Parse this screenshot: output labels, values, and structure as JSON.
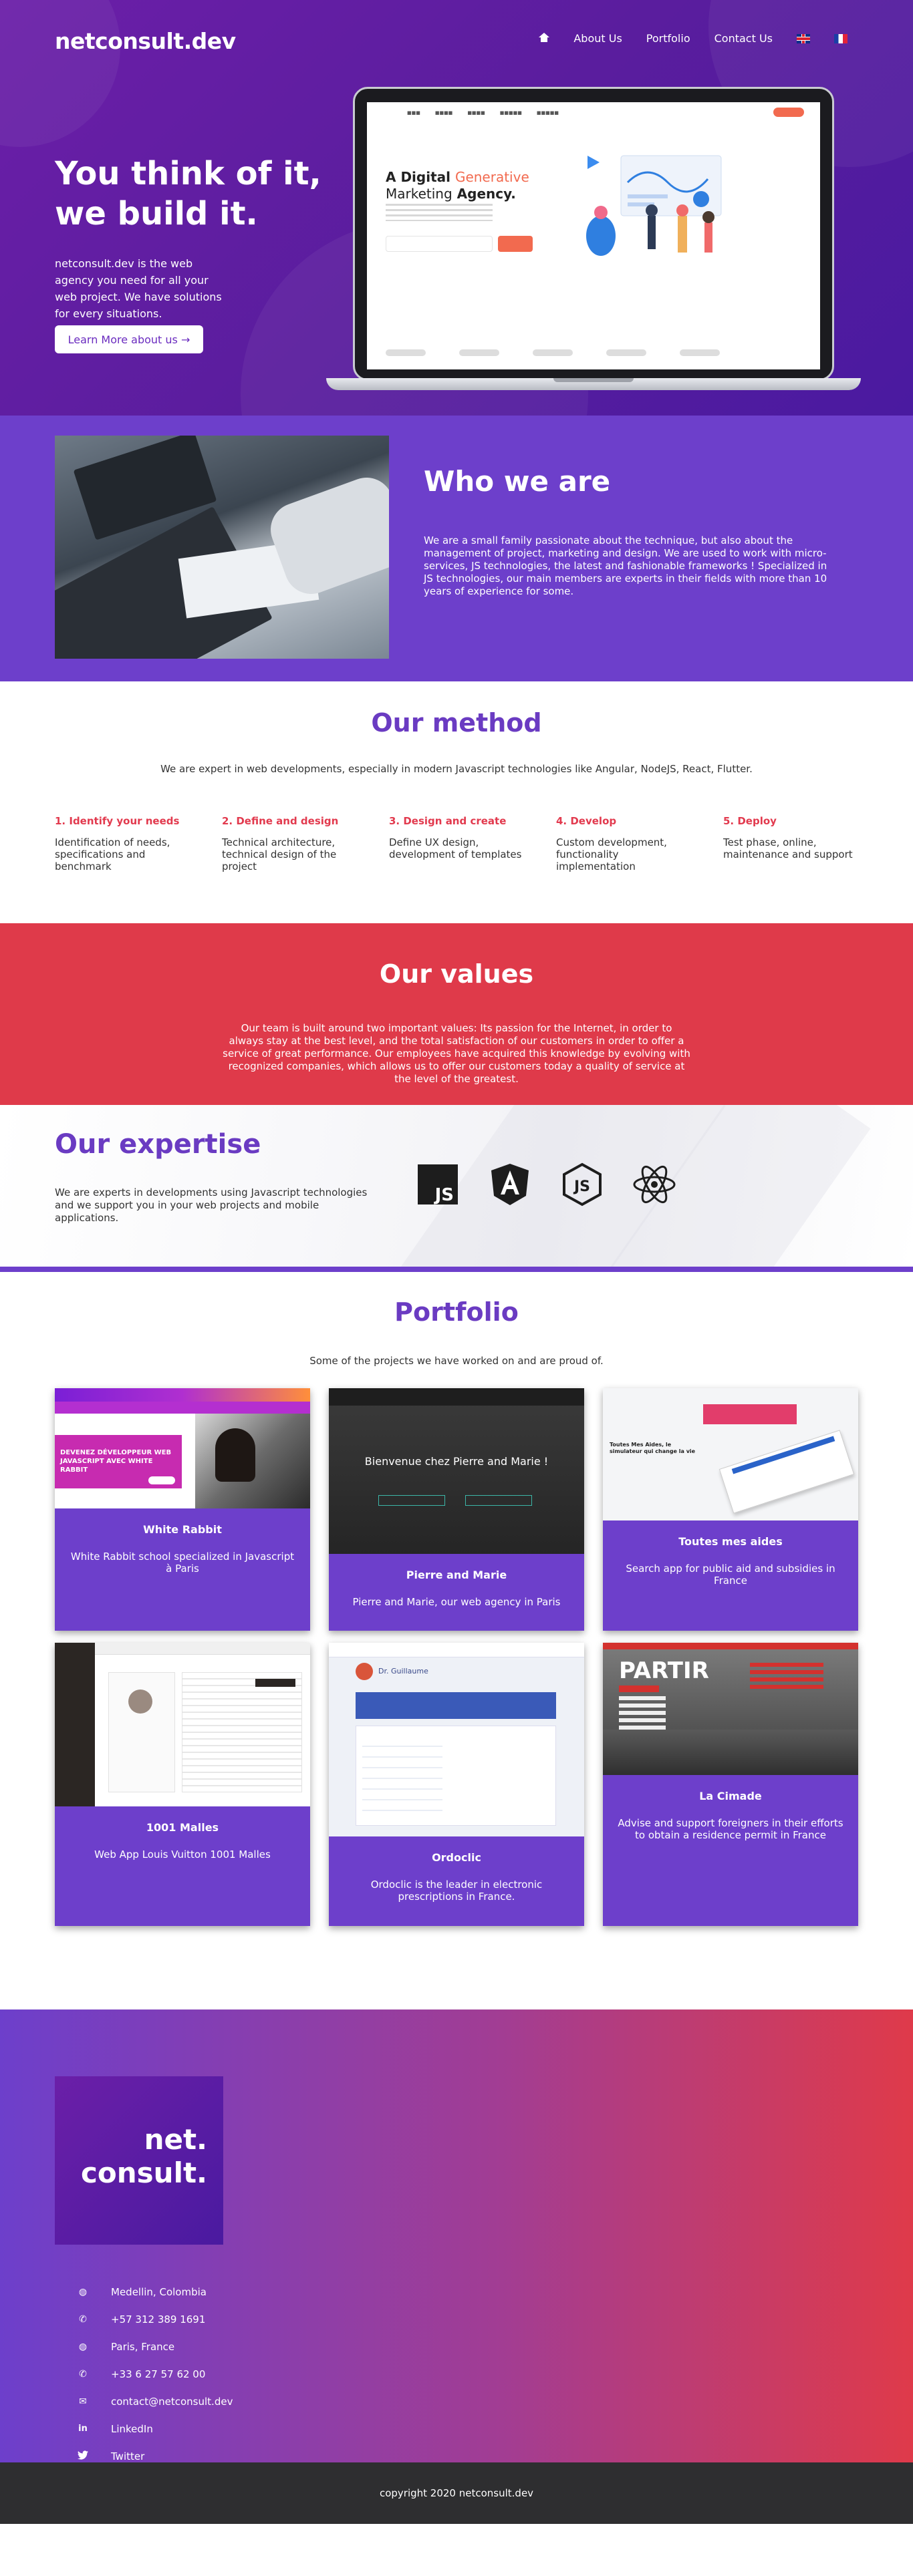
{
  "brand": {
    "name": "netconsult.dev"
  },
  "nav": {
    "about": "About Us",
    "portfolio": "Portfolio",
    "contact": "Contact Us",
    "icons": [
      "home-icon",
      "flag-uk-icon",
      "flag-fr-icon"
    ]
  },
  "hero": {
    "title_line1": "You think of it,",
    "title_line2": "we build it.",
    "text": "netconsult.dev is the web agency you need for all your web project. We have solutions for every situations.",
    "button": "Learn More about us →",
    "mock": {
      "title_a": "A Digital",
      "title_b": "Generative",
      "title_c": "Marketing",
      "title_d": "Agency."
    }
  },
  "who": {
    "title": "Who we are",
    "text": "We are a small family passionate about the technique, but also about the management of project, marketing and design. We are used to work with micro-services, JS technologies, the latest and fashionable frameworks ! Specialized in JS technologies, our main members are experts in their fields with more than 10 years of experience for some."
  },
  "method": {
    "title": "Our method",
    "subtitle": "We are expert in web developments, especially in modern Javascript technologies like Angular, NodeJS, React, Flutter.",
    "steps": [
      {
        "title": "1. Identify your needs",
        "text": "Identification of needs, specifications and benchmark"
      },
      {
        "title": "2. Define and design",
        "text": "Technical architecture, technical design of the project"
      },
      {
        "title": "3. Design and create",
        "text": "Define UX design, development of templates"
      },
      {
        "title": "4. Develop",
        "text": "Custom development, functionality implementation"
      },
      {
        "title": "5. Deploy",
        "text": "Test phase, online, maintenance and support"
      }
    ]
  },
  "values": {
    "title": "Our values",
    "text": "Our team is built around two important values: Its passion for the Internet, in order to always stay at the best level, and the total satisfaction of our customers in order to offer a service of great performance. Our employees have acquired this knowledge by evolving with recognized companies, which allows us to offer our customers today a quality of service at the level of the greatest."
  },
  "expertise": {
    "title": "Our expertise",
    "text": "We are experts in developments using Javascript technologies and we support you in your web projects and mobile applications.",
    "icons": [
      "javascript-icon",
      "angular-icon",
      "nodejs-icon",
      "react-icon"
    ]
  },
  "portfolio": {
    "title": "Portfolio",
    "subtitle": "Some of the projects we have worked on and are proud of.",
    "projects": [
      {
        "title": "White Rabbit",
        "desc": "White Rabbit school specialized in Javascript à Paris",
        "thumb_text": "DEVENEZ DÉVELOPPEUR WEB JAVASCRIPT AVEC WHITE RABBIT"
      },
      {
        "title": "Pierre and Marie",
        "desc": "Pierre and Marie, our web agency in Paris",
        "thumb_text": "Bienvenue chez Pierre and Marie !"
      },
      {
        "title": "Toutes mes aides",
        "desc": "Search app for public aid and subsidies in France",
        "thumb_text": "Toutes Mes Aides, le simulateur qui change la vie"
      },
      {
        "title": "1001 Malles",
        "desc": "Web App Louis Vuitton 1001 Malles",
        "thumb_text": ""
      },
      {
        "title": "Ordoclic",
        "desc": "Ordoclic is the leader in electronic prescriptions in France.",
        "thumb_text": "Dr. Guillaume"
      },
      {
        "title": "La Cimade",
        "desc": "Advise and support foreigners in their efforts to obtain a residence permit in France",
        "thumb_text": "PARTIR"
      }
    ]
  },
  "footer": {
    "logo_line1": "net.",
    "logo_line2": "consult.",
    "contacts": [
      {
        "icon": "globe-icon",
        "text": "Medellin, Colombia"
      },
      {
        "icon": "phone-icon",
        "text": "+57 312 389 1691"
      },
      {
        "icon": "globe-icon",
        "text": "Paris, France"
      },
      {
        "icon": "phone-icon",
        "text": "+33 6 27 57 62 00"
      },
      {
        "icon": "envelope-icon",
        "text": "contact@netconsult.dev"
      },
      {
        "icon": "linkedin-icon",
        "text": "LinkedIn"
      },
      {
        "icon": "twitter-icon",
        "text": "Twitter"
      }
    ],
    "copyright": "copyright 2020 netconsult.dev"
  },
  "colors": {
    "purple": "#6d3fcb",
    "hero": "#5a1d9e",
    "red": "#df3a4a",
    "heading": "#6a3bc2",
    "dark": "#2e2e30"
  }
}
